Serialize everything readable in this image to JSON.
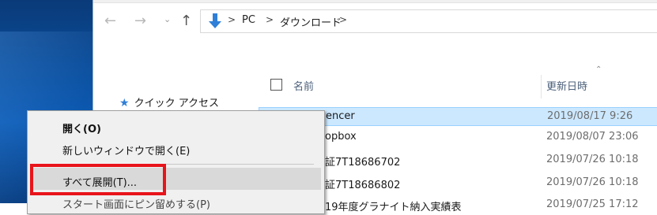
{
  "address": {
    "back_icon": "←",
    "forward_icon": "→",
    "recent_icon": "⌄",
    "up_icon": "↑",
    "folder_icon": "download-folder-icon",
    "sep": ">",
    "path": [
      "PC",
      "ダウンロード"
    ]
  },
  "nav_pane": {
    "quick_access": "クイック アクセス"
  },
  "columns": {
    "name": "名前",
    "date": "更新日時",
    "sort_indicator": "⌃"
  },
  "files": [
    {
      "name": "encer",
      "date": "2019/08/17 9:26",
      "selected": true
    },
    {
      "name": "opbox",
      "date": "2019/08/07 23:06",
      "selected": false
    },
    {
      "name": "証7T18686702",
      "date": "2019/07/26 10:18",
      "selected": false
    },
    {
      "name": "証7T18686802",
      "date": "2019/07/26 10:18",
      "selected": false
    },
    {
      "name": "19年度グラナイト納入実績表",
      "date": "2019/07/25 17:12",
      "selected": false
    }
  ],
  "context_menu": {
    "open": "開く(O)",
    "open_new_window": "新しいウィンドウで開く(E)",
    "extract_all": "すべて展開(T)...",
    "pin_to_start": "スタート画面にピン留めする(P)"
  },
  "colors": {
    "highlight_box": "#e8141b",
    "selection": "#cce8ff"
  }
}
